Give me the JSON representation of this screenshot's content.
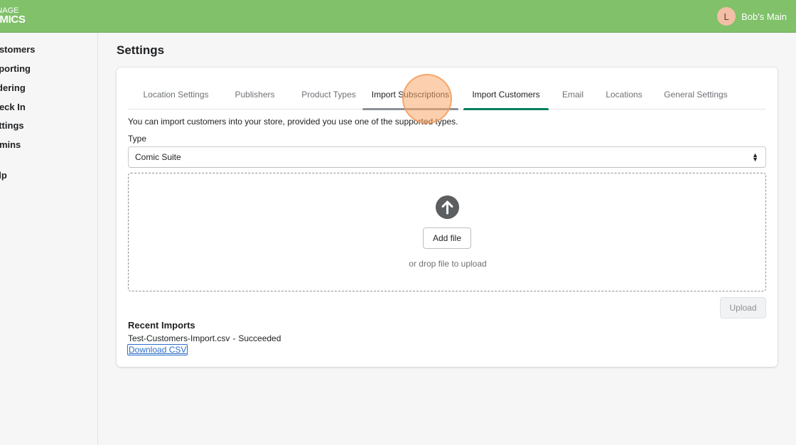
{
  "app": {
    "logo_line1": "ANAGE",
    "logo_line2": "OMICS",
    "user_initial": "L",
    "user_name": "Bob's Main"
  },
  "sidebar": {
    "items": [
      {
        "label": "ustomers"
      },
      {
        "label": "eporting"
      },
      {
        "label": "rdering"
      },
      {
        "label": "heck In"
      },
      {
        "label": "ettings"
      },
      {
        "label": "dmins"
      },
      {
        "label": "elp"
      }
    ]
  },
  "page": {
    "title": "Settings"
  },
  "tabs": [
    {
      "label": "Location Settings",
      "state": "default"
    },
    {
      "label": "Publishers",
      "state": "default"
    },
    {
      "label": "Product Types",
      "state": "default"
    },
    {
      "label": "Import Subscriptions",
      "state": "hover"
    },
    {
      "label": "Import Customers",
      "state": "selected"
    },
    {
      "label": "Email",
      "state": "default"
    },
    {
      "label": "Locations",
      "state": "default"
    },
    {
      "label": "General Settings",
      "state": "default"
    }
  ],
  "import": {
    "intro": "You can import customers into your store, provided you use one of the supported types.",
    "type_label": "Type",
    "type_value": "Comic Suite",
    "add_file_label": "Add file",
    "drop_hint": "or drop file to upload",
    "upload_label": "Upload"
  },
  "recent": {
    "title": "Recent Imports",
    "file_name": "Test-Customers-Import.csv",
    "separator": "-",
    "status": "Succeeded",
    "download_label": "Download CSV"
  },
  "colors": {
    "header": "#80c16a",
    "selected_tab": "#008060",
    "link": "#2c6ecb",
    "cursor_highlight": "#f6a05a"
  }
}
